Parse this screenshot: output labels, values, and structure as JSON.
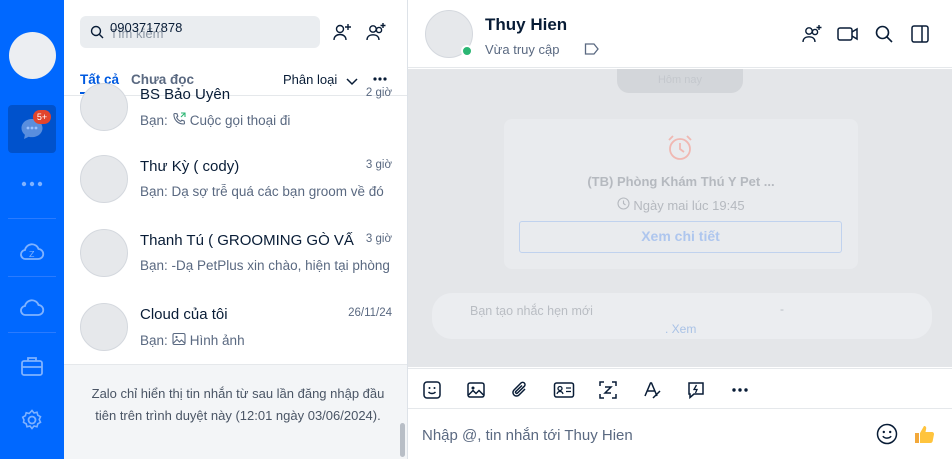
{
  "rail": {
    "badge": "5+",
    "icons": [
      "avatar",
      "chat-icon",
      "more-icon",
      "zcloud-icon",
      "cloud-icon",
      "toolbox-icon",
      "settings-icon"
    ]
  },
  "search": {
    "typed_value": "0903717878",
    "placeholder": "Tìm kiếm"
  },
  "tabs": {
    "all": "Tất cả",
    "unread": "Chưa đọc",
    "classify": "Phân loại"
  },
  "conversations": [
    {
      "name": "BS Bảo Uyên",
      "time": "2 giờ",
      "preview": "Cuộc gọi thoại đi",
      "prefix": "Bạn:",
      "icon": "phone-out-icon"
    },
    {
      "name": "Thư Kỳ ( cody)",
      "time": "3 giờ",
      "preview": "Bạn: Dạ sợ trễ quá các bạn groom về đó",
      "prefix": "",
      "icon": ""
    },
    {
      "name": "Thanh Tú ( GROOMING GÒ VẤ",
      "time": "3 giờ",
      "preview": "Bạn: -Dạ PetPlus xin chào, hiện tại phòng",
      "prefix": "",
      "icon": ""
    },
    {
      "name": "Cloud của tôi",
      "time": "26/11/24",
      "preview": "Hình ảnh",
      "prefix": "Bạn:",
      "icon": "image-icon"
    }
  ],
  "notice": "Zalo chỉ hiển thị tin nhắn từ sau lần đăng nhập đầu tiên trên trình duyệt này (12:01 ngày 03/06/2024).",
  "chat": {
    "name": "Thuy Hien",
    "status": "Vừa truy cập",
    "date_chip": "Hôm nay",
    "reminder": {
      "title": "(TB) Phòng Khám Thú Y Pet ...",
      "time": "Ngày mai lúc 19:45",
      "button": "Xem chi tiết"
    },
    "system": {
      "text": "Bạn tạo nhắc hẹn mới",
      "dash": "-",
      "link": ". Xem"
    },
    "composer_placeholder": "Nhập @, tin nhắn tới Thuy Hien"
  },
  "colors": {
    "brand": "#0068ff",
    "online": "#2bb673",
    "alarm": "#f0b8b2"
  }
}
